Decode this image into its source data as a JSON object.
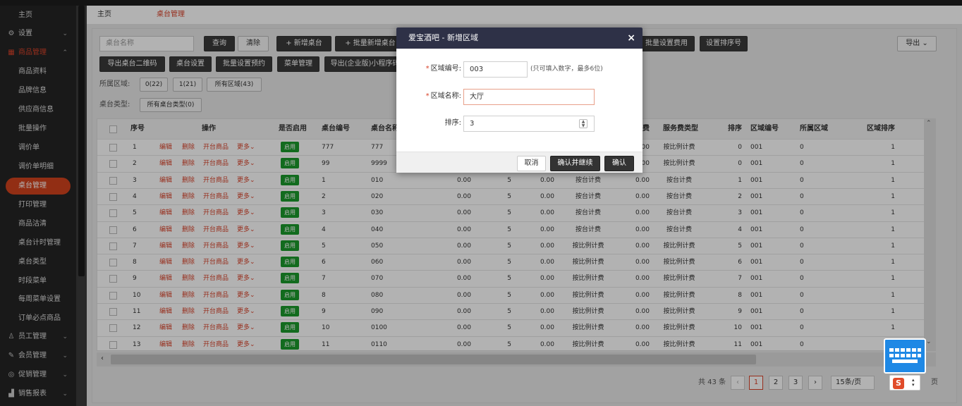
{
  "sidebar": {
    "items": [
      {
        "label": "主页",
        "icon": "",
        "chevron": ""
      },
      {
        "label": "设置",
        "icon": "gear-icon",
        "chevron": "⌄"
      },
      {
        "label": "商品管理",
        "icon": "box-icon",
        "chevron": "⌃"
      },
      {
        "label": "商品资料"
      },
      {
        "label": "品牌信息"
      },
      {
        "label": "供应商信息"
      },
      {
        "label": "批量操作"
      },
      {
        "label": "调价单"
      },
      {
        "label": "调价单明细"
      },
      {
        "label": "桌台管理"
      },
      {
        "label": "打印管理"
      },
      {
        "label": "商品沽清"
      },
      {
        "label": "桌台计时管理"
      },
      {
        "label": "桌台类型"
      },
      {
        "label": "时段菜单"
      },
      {
        "label": "每周菜单设置"
      },
      {
        "label": "订单必点商品"
      },
      {
        "label": "员工管理",
        "icon": "user-icon",
        "chevron": "⌄"
      },
      {
        "label": "会员管理",
        "icon": "member-icon",
        "chevron": "⌄"
      },
      {
        "label": "促销管理",
        "icon": "promo-icon",
        "chevron": "⌄"
      },
      {
        "label": "销售报表",
        "icon": "chart-icon",
        "chevron": "⌄"
      }
    ]
  },
  "tabs": {
    "home": "主页",
    "current": "桌台管理"
  },
  "toolbar": {
    "search_placeholder": "桌台名称",
    "query": "查询",
    "clear": "清除",
    "add_table": "+ 新增桌台",
    "batch_add_table": "+ 批量新增桌台",
    "batch_service_fee": "批量设置费用",
    "set_sort": "设置排序号",
    "export": "导出 ⌄",
    "export_qr": "导出桌台二维码",
    "table_settings": "桌台设置",
    "batch_reserve": "批量设置预约",
    "menu_mgmt": "菜单管理",
    "export_mini": "导出(企业版)小程序码"
  },
  "filters": {
    "area_label": "所属区域:",
    "area_chips": [
      "0(22)",
      "1(21)",
      "所有区域(43)"
    ],
    "type_label": "桌台类型:",
    "type_chips": [
      "所有桌台类型(0)"
    ]
  },
  "table": {
    "headers": {
      "seq": "序号",
      "op": "操作",
      "enabled": "是否启用",
      "code": "桌台编号",
      "name": "桌台名称",
      "fee": "费",
      "service_type": "服务费类型",
      "sort": "排序",
      "area_code": "区域编号",
      "area": "所属区域",
      "area_sort": "区域排序"
    },
    "ops": {
      "edit": "编辑",
      "del": "删除",
      "open": "开台商品",
      "more": "更多⌄"
    },
    "on_label": "启用",
    "rows": [
      {
        "seq": "1",
        "code": "777",
        "name": "777",
        "v1": "",
        "v2": "",
        "v3": "",
        "svc": "按比例计费",
        "fee": "0.00",
        "sort": "0",
        "area_code": "001",
        "area": "0",
        "area_sort": "1"
      },
      {
        "seq": "2",
        "code": "99",
        "name": "9999",
        "v1": "",
        "v2": "",
        "v3": "",
        "svc": "按比例计费",
        "fee": "0.00",
        "sort": "0",
        "area_code": "001",
        "area": "0",
        "area_sort": "1"
      },
      {
        "seq": "3",
        "code": "1",
        "name": "010",
        "v1": "0.00",
        "v2": "5",
        "v3": "0.00",
        "svc": "按台计费",
        "fee": "0.00",
        "sort": "1",
        "area_code": "001",
        "area": "0",
        "area_sort": "1"
      },
      {
        "seq": "4",
        "code": "2",
        "name": "020",
        "v1": "0.00",
        "v2": "5",
        "v3": "0.00",
        "svc": "按台计费",
        "fee": "0.00",
        "sort": "2",
        "area_code": "001",
        "area": "0",
        "area_sort": "1"
      },
      {
        "seq": "5",
        "code": "3",
        "name": "030",
        "v1": "0.00",
        "v2": "5",
        "v3": "0.00",
        "svc": "按台计费",
        "fee": "0.00",
        "sort": "3",
        "area_code": "001",
        "area": "0",
        "area_sort": "1"
      },
      {
        "seq": "6",
        "code": "4",
        "name": "040",
        "v1": "0.00",
        "v2": "5",
        "v3": "0.00",
        "svc": "按台计费",
        "fee": "0.00",
        "sort": "4",
        "area_code": "001",
        "area": "0",
        "area_sort": "1"
      },
      {
        "seq": "7",
        "code": "5",
        "name": "050",
        "v1": "0.00",
        "v2": "5",
        "v3": "0.00",
        "svc": "按比例计费",
        "fee": "0.00",
        "sort": "5",
        "area_code": "001",
        "area": "0",
        "area_sort": "1"
      },
      {
        "seq": "8",
        "code": "6",
        "name": "060",
        "v1": "0.00",
        "v2": "5",
        "v3": "0.00",
        "svc": "按比例计费",
        "fee": "0.00",
        "sort": "6",
        "area_code": "001",
        "area": "0",
        "area_sort": "1"
      },
      {
        "seq": "9",
        "code": "7",
        "name": "070",
        "v1": "0.00",
        "v2": "5",
        "v3": "0.00",
        "svc": "按比例计费",
        "fee": "0.00",
        "sort": "7",
        "area_code": "001",
        "area": "0",
        "area_sort": "1"
      },
      {
        "seq": "10",
        "code": "8",
        "name": "080",
        "v1": "0.00",
        "v2": "5",
        "v3": "0.00",
        "svc": "按比例计费",
        "fee": "0.00",
        "sort": "8",
        "area_code": "001",
        "area": "0",
        "area_sort": "1"
      },
      {
        "seq": "11",
        "code": "9",
        "name": "090",
        "v1": "0.00",
        "v2": "5",
        "v3": "0.00",
        "svc": "按比例计费",
        "fee": "0.00",
        "sort": "9",
        "area_code": "001",
        "area": "0",
        "area_sort": "1"
      },
      {
        "seq": "12",
        "code": "10",
        "name": "0100",
        "v1": "0.00",
        "v2": "5",
        "v3": "0.00",
        "svc": "按比例计费",
        "fee": "0.00",
        "sort": "10",
        "area_code": "001",
        "area": "0",
        "area_sort": "1"
      },
      {
        "seq": "13",
        "code": "11",
        "name": "0110",
        "v1": "0.00",
        "v2": "5",
        "v3": "0.00",
        "svc": "按比例计费",
        "fee": "0.00",
        "sort": "11",
        "area_code": "001",
        "area": "0",
        "area_sort": "1"
      }
    ]
  },
  "pager": {
    "total": "共 43 条",
    "prev": "‹",
    "pages": [
      "1",
      "2",
      "3"
    ],
    "next": "›",
    "size": "15条/页",
    "page_suffix": "页"
  },
  "modal": {
    "title": "爱宝酒吧 - 新增区域",
    "close": "×",
    "code_label": "区域编号:",
    "code_value": "003",
    "code_hint": "(只可填入数字，最多6位)",
    "name_label": "区域名称:",
    "name_value": "大厅",
    "sort_label": "排序:",
    "sort_value": "3",
    "cancel": "取消",
    "confirm_continue": "确认并继续",
    "confirm": "确认"
  },
  "colors": {
    "accent": "#d9432a",
    "dark": "#2e3147",
    "green": "#1b9a2c"
  }
}
